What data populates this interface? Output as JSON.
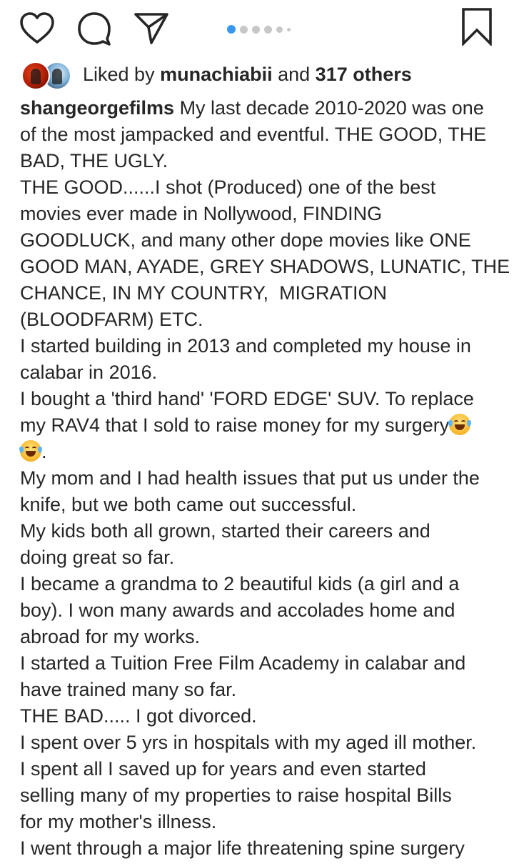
{
  "actions": {
    "like_icon": "heart-icon",
    "comment_icon": "comment-icon",
    "share_icon": "send-icon",
    "save_icon": "bookmark-icon",
    "carousel": {
      "total_dots": 6,
      "active_index": 0,
      "accent_color": "#3897f0"
    }
  },
  "likes": {
    "prefix": "Liked by ",
    "user": "munachiabii",
    "middle": " and ",
    "others": "317 others"
  },
  "caption": {
    "username": "shangeorgefilms",
    "first_line_text": " My last decade 2010-2020 was one",
    "lines": [
      "of the most jampacked and eventful. THE GOOD, THE",
      "BAD, THE UGLY.",
      "THE GOOD......I shot (Produced) one of the best",
      "movies ever made in Nollywood, FINDING",
      "GOODLUCK, and many other dope movies like ONE",
      "GOOD MAN, AYADE, GREY SHADOWS, LUNATIC, THE",
      "CHANCE, IN MY COUNTRY,  MIGRATION",
      "(BLOODFARM) ETC.",
      "I started building in 2013 and completed my house in",
      "calabar in 2016.",
      "I bought a 'third hand' 'FORD EDGE' SUV. To replace",
      "my RAV4 that I sold to raise money for my surgery",
      "",
      "My mom and I had health issues that put us under the",
      "knife, but we both came out successful.",
      "My kids both all grown, started their careers and",
      "doing great so far.",
      "I became a grandma to 2 beautiful kids (a girl and a",
      "boy). I won many awards and accolades home and",
      "abroad for my works.",
      "I started a Tuition Free Film Academy in calabar and",
      "have trained many so far.",
      "THE BAD..... I got divorced.",
      "I spent over 5 yrs in hospitals with my aged ill mother.",
      "I spent all I saved up for years and even started",
      "selling many of my properties to raise hospital Bills",
      "for my mother's illness.",
      "I went through a major life threatening spine surgery"
    ],
    "emoji_line_suffix": ".",
    "emoji_name": "face-with-tears-of-joy-icon"
  }
}
